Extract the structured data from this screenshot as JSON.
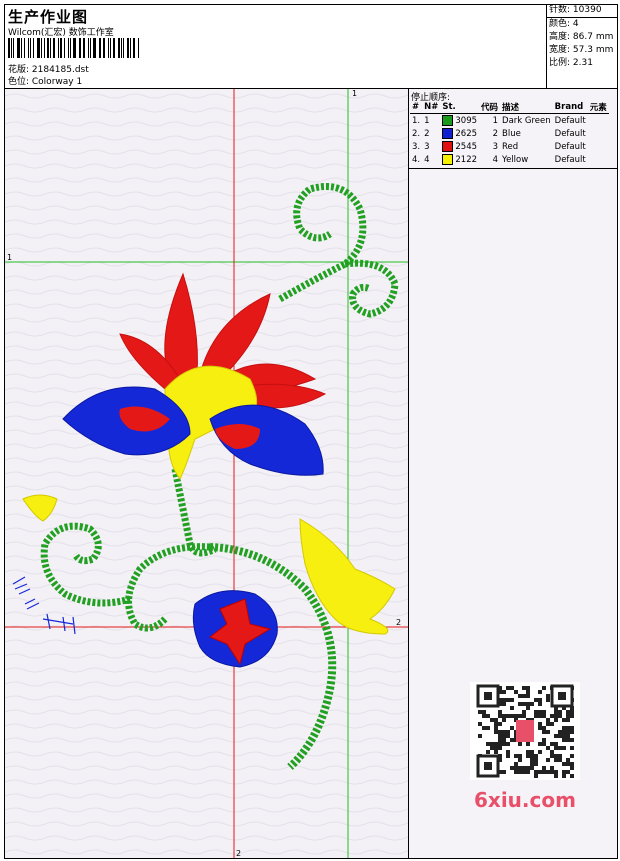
{
  "header": {
    "title": "生产作业图",
    "subtitle": "Wilcom(汇宏) 数饰工作室",
    "pattern": "花版: 2184185.dst",
    "colorway": "色位: Colorway 1"
  },
  "stats": [
    {
      "label": "针数",
      "value": "10390"
    },
    {
      "label": "颜色",
      "value": "4"
    },
    {
      "label": "高度",
      "value": "86.7 mm"
    },
    {
      "label": "宽度",
      "value": "57.3 mm"
    },
    {
      "label": "比例",
      "value": "2.31"
    }
  ],
  "stop_sequence": {
    "title": "停止顺序:",
    "columns": [
      "#",
      "N#",
      "St.",
      "代码",
      "描述",
      "Brand",
      "元素"
    ],
    "rows": [
      {
        "index": "1.",
        "n": "1",
        "swatch": "#1a9a1a",
        "st": "3095",
        "code": "1",
        "desc": "Dark Green",
        "brand": "Default"
      },
      {
        "index": "2.",
        "n": "2",
        "swatch": "#1020d0",
        "st": "2625",
        "code": "2",
        "desc": "Blue",
        "brand": "Default"
      },
      {
        "index": "3.",
        "n": "3",
        "swatch": "#e01010",
        "st": "2545",
        "code": "3",
        "desc": "Red",
        "brand": "Default"
      },
      {
        "index": "4.",
        "n": "4",
        "swatch": "#f5f000",
        "st": "2122",
        "code": "4",
        "desc": "Yellow",
        "brand": "Default"
      }
    ]
  },
  "guides": {
    "v1": "1",
    "h1": "1",
    "h2": "2",
    "v2": "2"
  },
  "watermark": "6xiu.com",
  "colors": {
    "green": "#22a022",
    "blue": "#1428d8",
    "red": "#e51818",
    "yellow": "#f6ef10"
  }
}
